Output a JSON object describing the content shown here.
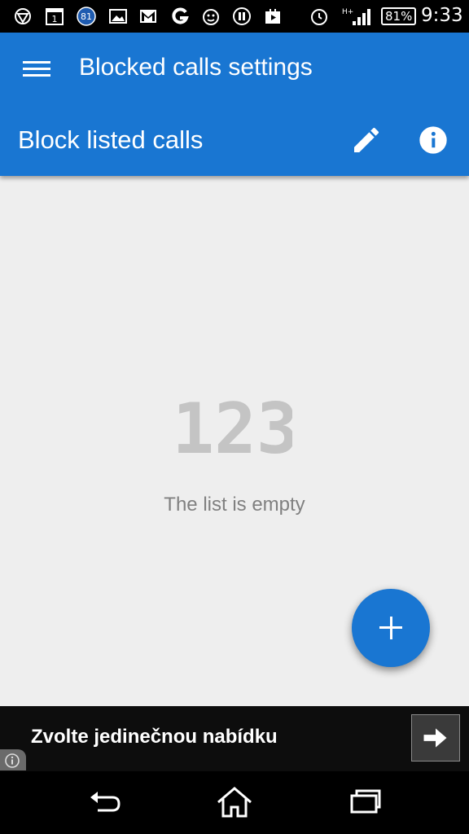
{
  "status_bar": {
    "battery": "81%",
    "time": "9:33",
    "network": "H+",
    "notification_badge": "81",
    "calendar_day": "1",
    "icons": [
      "app-icon",
      "calendar-icon",
      "badge-icon",
      "image-icon",
      "gmail-icon",
      "g-icon",
      "monkey-icon",
      "game-icon",
      "play-store-icon",
      "alarm-icon",
      "signal-icon",
      "battery-icon"
    ]
  },
  "app_bar": {
    "title": "Blocked calls settings",
    "subtitle": "Block listed calls",
    "icons": [
      "menu-icon",
      "edit-icon",
      "info-icon"
    ]
  },
  "empty_state": {
    "graphic_text": "123",
    "message": "The list is empty"
  },
  "fab": {
    "icon": "plus-icon"
  },
  "ad": {
    "text": "Zvolte jedinečnou nabídku",
    "icons": [
      "arrow-right-icon",
      "info-icon"
    ]
  },
  "nav": {
    "icons": [
      "back-icon",
      "home-icon",
      "recent-apps-icon"
    ]
  },
  "colors": {
    "primary": "#1976d2",
    "background": "#eeeeee",
    "empty_graphic": "#c4c4c4",
    "empty_text": "#808080"
  }
}
